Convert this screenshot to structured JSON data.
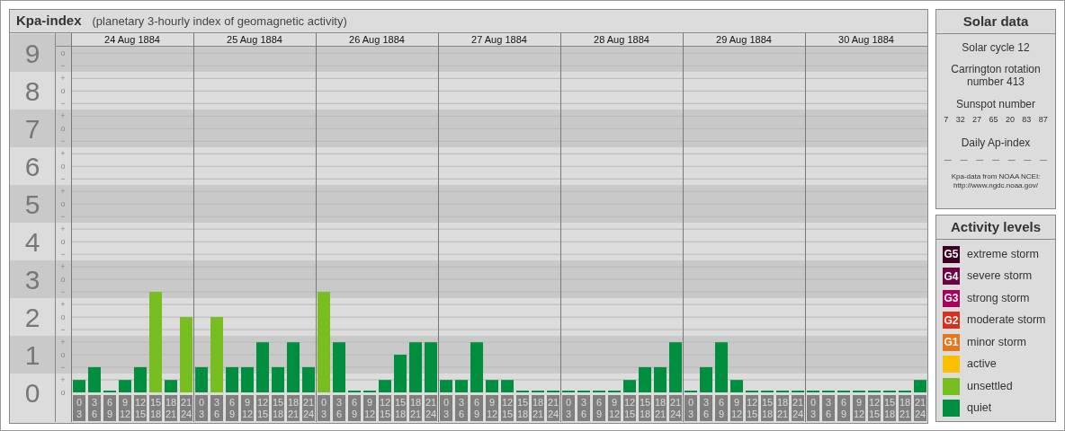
{
  "header": {
    "title": "Kpa-index",
    "subtitle": "(planetary 3-hourly index of geomagnetic activity)"
  },
  "chart": {
    "days": [
      {
        "date": "24 Aug 1884",
        "slots": [
          {
            "from": "0",
            "to": "3"
          },
          {
            "from": "3",
            "to": "6"
          },
          {
            "from": "6",
            "to": "9"
          },
          {
            "from": "9",
            "to": "12"
          },
          {
            "from": "12",
            "to": "15"
          },
          {
            "from": "15",
            "to": "18"
          },
          {
            "from": "18",
            "to": "21"
          },
          {
            "from": "21",
            "to": "24"
          }
        ]
      },
      {
        "date": "25 Aug 1884",
        "slots": [
          {
            "from": "0",
            "to": "3"
          },
          {
            "from": "3",
            "to": "6"
          },
          {
            "from": "6",
            "to": "9"
          },
          {
            "from": "9",
            "to": "12"
          },
          {
            "from": "12",
            "to": "15"
          },
          {
            "from": "15",
            "to": "18"
          },
          {
            "from": "18",
            "to": "21"
          },
          {
            "from": "21",
            "to": "24"
          }
        ]
      },
      {
        "date": "26 Aug 1884",
        "slots": [
          {
            "from": "0",
            "to": "3"
          },
          {
            "from": "3",
            "to": "6"
          },
          {
            "from": "6",
            "to": "9"
          },
          {
            "from": "9",
            "to": "12"
          },
          {
            "from": "12",
            "to": "15"
          },
          {
            "from": "15",
            "to": "18"
          },
          {
            "from": "18",
            "to": "21"
          },
          {
            "from": "21",
            "to": "24"
          }
        ]
      },
      {
        "date": "27 Aug 1884",
        "slots": [
          {
            "from": "0",
            "to": "3"
          },
          {
            "from": "3",
            "to": "6"
          },
          {
            "from": "6",
            "to": "9"
          },
          {
            "from": "9",
            "to": "12"
          },
          {
            "from": "12",
            "to": "15"
          },
          {
            "from": "15",
            "to": "18"
          },
          {
            "from": "18",
            "to": "21"
          },
          {
            "from": "21",
            "to": "24"
          }
        ]
      },
      {
        "date": "28 Aug 1884",
        "slots": [
          {
            "from": "0",
            "to": "3"
          },
          {
            "from": "3",
            "to": "6"
          },
          {
            "from": "6",
            "to": "9"
          },
          {
            "from": "9",
            "to": "12"
          },
          {
            "from": "12",
            "to": "15"
          },
          {
            "from": "15",
            "to": "18"
          },
          {
            "from": "18",
            "to": "21"
          },
          {
            "from": "21",
            "to": "24"
          }
        ]
      },
      {
        "date": "29 Aug 1884",
        "slots": [
          {
            "from": "0",
            "to": "3"
          },
          {
            "from": "3",
            "to": "6"
          },
          {
            "from": "6",
            "to": "9"
          },
          {
            "from": "9",
            "to": "12"
          },
          {
            "from": "12",
            "to": "15"
          },
          {
            "from": "15",
            "to": "18"
          },
          {
            "from": "18",
            "to": "21"
          },
          {
            "from": "21",
            "to": "24"
          }
        ]
      },
      {
        "date": "30 Aug 1884",
        "slots": [
          {
            "from": "0",
            "to": "3"
          },
          {
            "from": "3",
            "to": "6"
          },
          {
            "from": "6",
            "to": "9"
          },
          {
            "from": "9",
            "to": "12"
          },
          {
            "from": "12",
            "to": "15"
          },
          {
            "from": "15",
            "to": "18"
          },
          {
            "from": "18",
            "to": "21"
          },
          {
            "from": "21",
            "to": "24"
          }
        ]
      }
    ],
    "minor_ticks": [
      "o",
      "−",
      "+",
      "o",
      "−",
      "+",
      "o",
      "−",
      "+",
      "o",
      "−",
      "+",
      "o",
      "−",
      "+",
      "o",
      "−",
      "+",
      "o",
      "−",
      "+",
      "o",
      "−",
      "+",
      "o",
      "−",
      "+",
      "o"
    ],
    "chart_data": {
      "type": "bar",
      "grid": true,
      "ylim": [
        0,
        9.2
      ],
      "yticks": [
        {
          "value": 0,
          "label": "0"
        },
        {
          "value": 1,
          "label": "1"
        },
        {
          "value": 2,
          "label": "2"
        },
        {
          "value": 3,
          "label": "3"
        },
        {
          "value": 4,
          "label": "4"
        },
        {
          "value": 5,
          "label": "5"
        },
        {
          "value": 6,
          "label": "6"
        },
        {
          "value": 7,
          "label": "7"
        },
        {
          "value": 8,
          "label": "8"
        },
        {
          "value": 9,
          "label": "9"
        }
      ],
      "series": [
        {
          "color": "#008f3e",
          "values": [
            0.33,
            0.67,
            0,
            0.33,
            0.67,
            null,
            0.33,
            null,
            0.67,
            null,
            0.67,
            0.67,
            1.33,
            0.67,
            1.33,
            0.67,
            null,
            1.33,
            0,
            0,
            0.33,
            1,
            1.33,
            1.33,
            0.33,
            0.33,
            1.33,
            0.33,
            0.33,
            0,
            0,
            0,
            0,
            0,
            0,
            0,
            0.33,
            0.67,
            0.67,
            1.33,
            0,
            0.67,
            1.33,
            0.33,
            0,
            0,
            0,
            0,
            0,
            0,
            0,
            0,
            0,
            0,
            0,
            0.33
          ]
        },
        {
          "color": "#78be20",
          "values": [
            null,
            null,
            null,
            null,
            null,
            2.67,
            null,
            2,
            null,
            2,
            null,
            null,
            null,
            null,
            null,
            null,
            2.67,
            null,
            null,
            null,
            null,
            null,
            null,
            null,
            null,
            null,
            null,
            null,
            null,
            null,
            null,
            null,
            null,
            null,
            null,
            null,
            null,
            null,
            null,
            null,
            null,
            null,
            null,
            null,
            null,
            null,
            null,
            null,
            null,
            null,
            null,
            null,
            null,
            null,
            null,
            null
          ]
        }
      ]
    }
  },
  "solar_data": {
    "title": "Solar data",
    "solar_cycle": "Solar cycle 12",
    "carrington": "Carrington rotation number 413",
    "sunspot_title": "Sunspot number",
    "sunspots": [
      "7",
      "32",
      "27",
      "65",
      "20",
      "83",
      "87"
    ],
    "ap_title": "Daily Ap-index",
    "ap_values": [
      "—",
      "—",
      "—",
      "—",
      "—",
      "—",
      "—"
    ],
    "source": "Kpa-data from NOAA NCEI:",
    "source_url": "http://www.ngdc.noaa.gov/"
  },
  "activity_levels": {
    "title": "Activity levels",
    "items": [
      {
        "badge": "G5",
        "label": "extreme storm",
        "color": "#3d0022"
      },
      {
        "badge": "G4",
        "label": "severe storm",
        "color": "#6b0043"
      },
      {
        "badge": "G3",
        "label": "strong storm",
        "color": "#a8005c"
      },
      {
        "badge": "G2",
        "label": "moderate storm",
        "color": "#d9301c"
      },
      {
        "badge": "G1",
        "label": "minor storm",
        "color": "#e8751a"
      },
      {
        "label": "active",
        "color": "#f9c000"
      },
      {
        "label": "unsettled",
        "color": "#78be20"
      },
      {
        "label": "quiet",
        "color": "#008f3e"
      }
    ]
  }
}
